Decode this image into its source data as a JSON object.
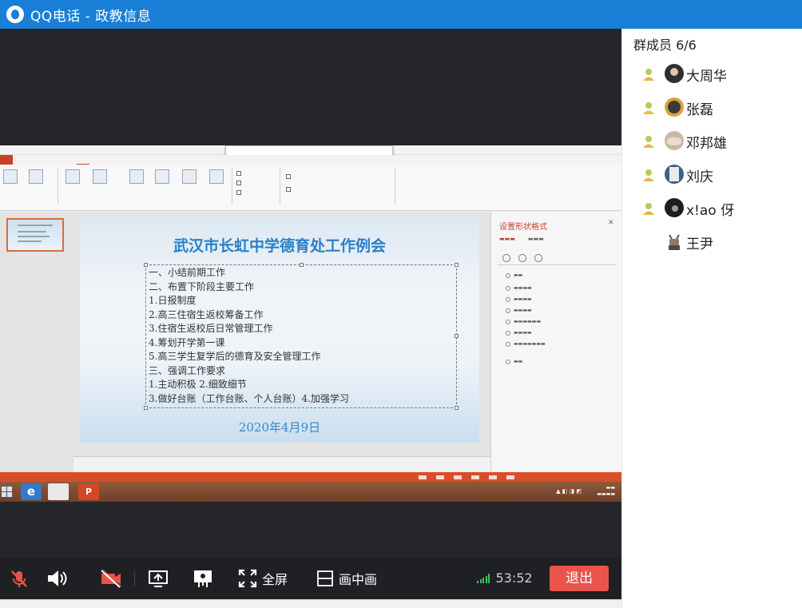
{
  "window": {
    "title": "QQ电话 - 政教信息"
  },
  "slide": {
    "title": "武汉市长虹中学德育处工作例会",
    "lines": [
      "一、小结前期工作",
      "二、布置下阶段主要工作",
      "1.日报制度",
      "2.高三住宿生返校筹备工作",
      "3.住宿生返校后日常管理工作",
      "4.筹划开学第一课",
      "5.高三学生复学后的德育及安全管理工作",
      "三、强调工作要求",
      "1.主动积极      2.细致细节",
      "3.做好台账（工作台账、个人台账）4.加强学习"
    ],
    "date": "2020年4月9日"
  },
  "ppt_pane": {
    "title": "设置形状格式"
  },
  "controls": {
    "fullscreen_label": "全屏",
    "pip_label": "画中画",
    "timer": "53:52",
    "exit_label": "退出"
  },
  "members": {
    "header": "群成员 6/6",
    "list": [
      {
        "name": "大周华",
        "avatar_color": "#2f2f2f",
        "online": true
      },
      {
        "name": "张磊",
        "avatar_color": "#d9a33a",
        "online": true
      },
      {
        "name": "邓邦雄",
        "avatar_color": "#c9b8a4",
        "online": true
      },
      {
        "name": "刘庆",
        "avatar_color": "#3a5f8a",
        "online": true
      },
      {
        "name": "x!ao 伢",
        "avatar_color": "#1e1e1e",
        "online": true
      },
      {
        "name": "王尹",
        "avatar_color": "#6b5b4d",
        "online": false
      }
    ]
  },
  "colors": {
    "titlebar": "#1a7fd6",
    "exit_button": "#e8544c",
    "signal": "#3ec15a",
    "member_status": "#9bbf4a"
  }
}
